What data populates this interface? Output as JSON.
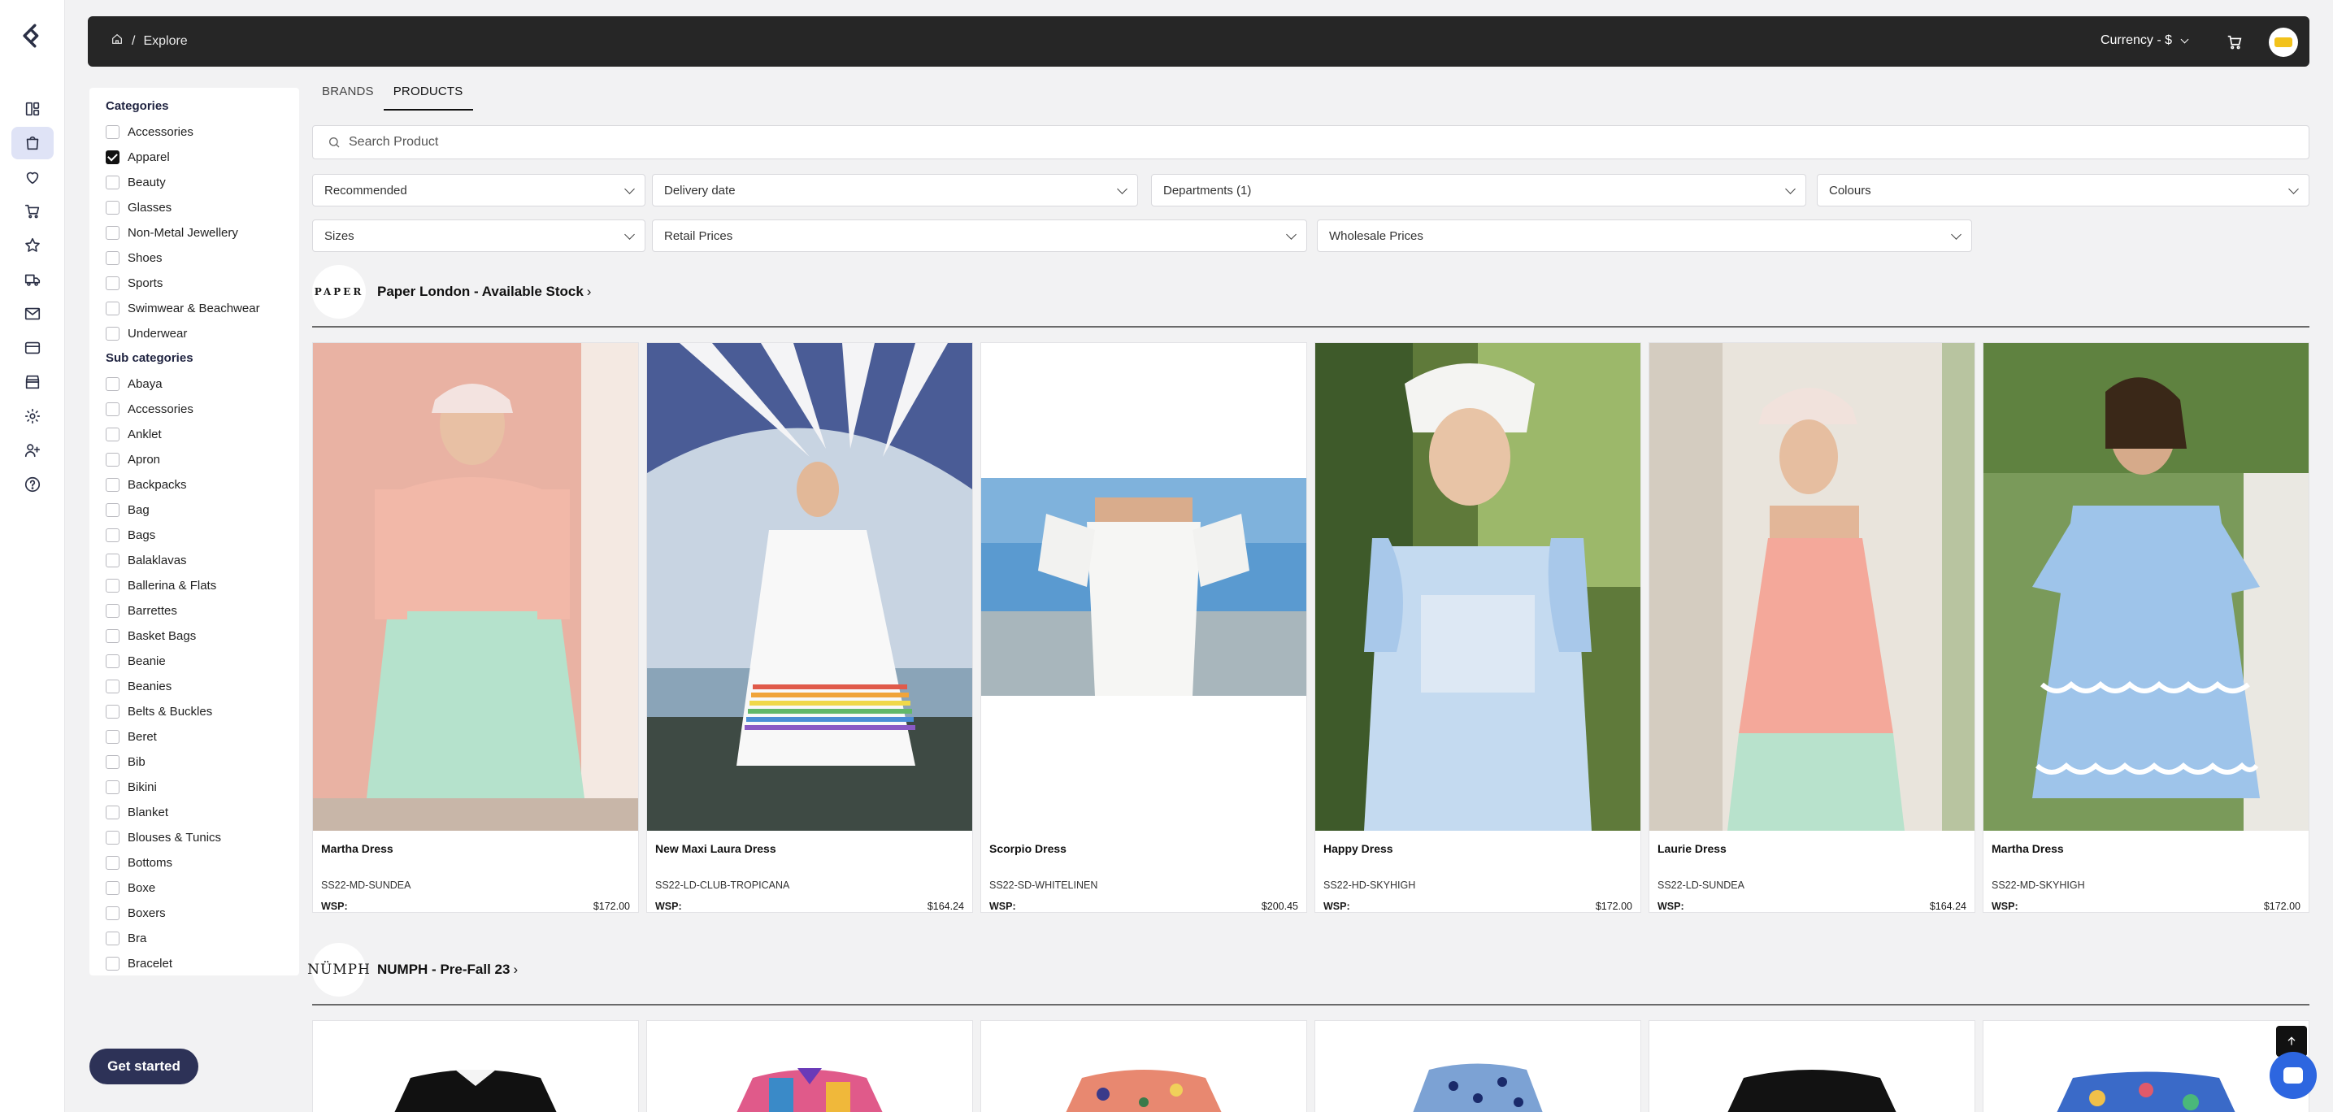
{
  "breadcrumb": {
    "current": "Explore",
    "separator": "/"
  },
  "topbar": {
    "currency_label": "Currency - $"
  },
  "filters": {
    "categories_title": "Categories",
    "categories": [
      {
        "label": "Accessories",
        "checked": false
      },
      {
        "label": "Apparel",
        "checked": true
      },
      {
        "label": "Beauty",
        "checked": false
      },
      {
        "label": "Glasses",
        "checked": false
      },
      {
        "label": "Non-Metal Jewellery",
        "checked": false
      },
      {
        "label": "Shoes",
        "checked": false
      },
      {
        "label": "Sports",
        "checked": false
      },
      {
        "label": "Swimwear & Beachwear",
        "checked": false
      },
      {
        "label": "Underwear",
        "checked": false
      }
    ],
    "subcategories_title": "Sub categories",
    "subcategories": [
      "Abaya",
      "Accessories",
      "Anklet",
      "Apron",
      "Backpacks",
      "Bag",
      "Bags",
      "Balaklavas",
      "Ballerina & Flats",
      "Barrettes",
      "Basket Bags",
      "Beanie",
      "Beanies",
      "Belts & Buckles",
      "Beret",
      "Bib",
      "Bikini",
      "Blanket",
      "Blouses & Tunics",
      "Bottoms",
      "Boxe",
      "Boxers",
      "Bra",
      "Bracelet"
    ]
  },
  "tabs": [
    "BRANDS",
    "PRODUCTS"
  ],
  "search": {
    "placeholder": "Search Product"
  },
  "dropdowns": {
    "sort": "Recommended",
    "delivery": "Delivery date",
    "departments": "Departments (1)",
    "colours": "Colours",
    "sizes": "Sizes",
    "retail": "Retail Prices",
    "wholesale": "Wholesale Prices"
  },
  "brands": [
    {
      "logo_text": "PAPER",
      "name": "Paper London - Available Stock",
      "arrow": "›",
      "products": [
        {
          "name": "Martha Dress",
          "sku": "SS22-MD-SUNDEA",
          "wsp_label": "WSP:",
          "price": "$172.00"
        },
        {
          "name": "New Maxi Laura Dress",
          "sku": "SS22-LD-CLUB-TROPICANA",
          "wsp_label": "WSP:",
          "price": "$164.24"
        },
        {
          "name": "Scorpio Dress",
          "sku": "SS22-SD-WHITELINEN",
          "wsp_label": "WSP:",
          "price": "$200.45"
        },
        {
          "name": "Happy Dress",
          "sku": "SS22-HD-SKYHIGH",
          "wsp_label": "WSP:",
          "price": "$172.00"
        },
        {
          "name": "Laurie Dress",
          "sku": "SS22-LD-SUNDEA",
          "wsp_label": "WSP:",
          "price": "$164.24"
        },
        {
          "name": "Martha Dress",
          "sku": "SS22-MD-SKYHIGH",
          "wsp_label": "WSP:",
          "price": "$172.00"
        }
      ]
    },
    {
      "logo_text": "NÜMPH",
      "name": "NUMPH - Pre-Fall 23",
      "arrow": "›"
    }
  ],
  "cta": {
    "get_started": "Get started"
  }
}
